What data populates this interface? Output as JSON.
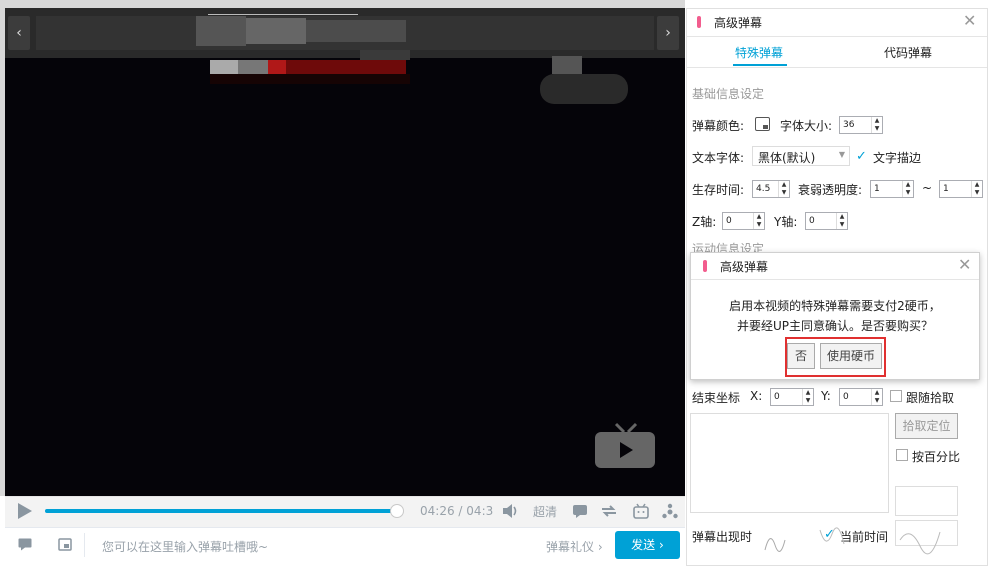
{
  "player": {
    "time_current": "04:26",
    "time_sep": "/",
    "time_total": "04:3",
    "quality": "超清",
    "progress_fraction": 0.97
  },
  "input_bar": {
    "placeholder": "您可以在这里输入弹幕吐槽哦~",
    "etiquette": "弹幕礼仪",
    "etiquette_arrow": "›",
    "send": "发送",
    "send_arrow": "›"
  },
  "panel": {
    "title": "高级弹幕",
    "tabs": [
      "特殊弹幕",
      "代码弹幕"
    ],
    "active_tab": 0,
    "section_basic": "基础信息设定",
    "color_label": "弹幕颜色:",
    "font_size_label": "字体大小:",
    "font_size_value": "36",
    "font_label": "文本字体:",
    "font_value": "黑体(默认)",
    "stroke_label": "文字描边",
    "stroke_checked": true,
    "lifetime_label": "生存时间:",
    "lifetime_value": "4.5",
    "fade_label": "衰弱透明度:",
    "fade_from": "1",
    "fade_sep": "~",
    "fade_to": "1",
    "z_label": "Z轴:",
    "z_value": "0",
    "y_label": "Y轴:",
    "y_value": "0",
    "section_motion": "运动信息设定",
    "end_coord_label": "结束坐标",
    "x_label": "X:",
    "end_x": "0",
    "end_y_label": "Y:",
    "end_y": "0",
    "follow_label": "跟随拾取",
    "pick_btn": "拾取定位",
    "percent_label": "按百分比",
    "appear_label": "弹幕出现时",
    "current_time_label": "当前时间",
    "current_time_checked": true
  },
  "dialog": {
    "title": "高级弹幕",
    "message_line1": "启用本视频的特殊弹幕需要支付2硬币，",
    "message_line2": "并要经UP主同意确认。是否要购买？",
    "no_btn": "否",
    "yes_btn": "使用硬币"
  },
  "icons": {
    "close": "close-icon",
    "prev": "chevron-left-icon",
    "next": "chevron-right-icon",
    "play": "play-icon",
    "volume": "volume-icon",
    "danmaku": "danmaku-icon",
    "loop": "loop-icon",
    "bilibili": "bilibili-tv-icon",
    "settings": "settings-icon"
  },
  "colors": {
    "accent": "#00a1d6",
    "pink": "#f25d8e",
    "highlight": "#e03030"
  }
}
